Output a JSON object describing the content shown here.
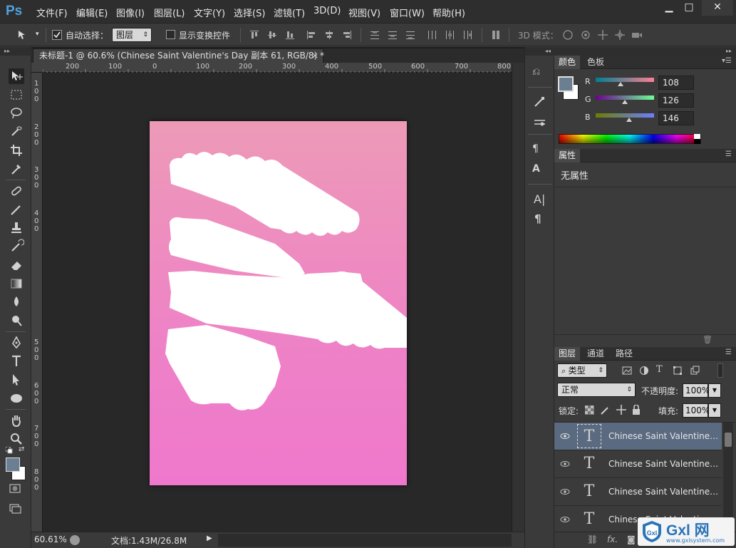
{
  "app": {
    "logo": "Ps",
    "menu": [
      "文件(F)",
      "编辑(E)",
      "图像(I)",
      "图层(L)",
      "文字(Y)",
      "选择(S)",
      "滤镜(T)",
      "3D(D)",
      "视图(V)",
      "窗口(W)",
      "帮助(H)"
    ],
    "window_controls": {
      "minimize": "▁",
      "maximize": "□",
      "close": "✕"
    }
  },
  "options_bar": {
    "auto_select_label": "自动选择：",
    "auto_select_value": "图层",
    "show_transform_label": "显示变换控件",
    "mode_3d_label": "3D 模式："
  },
  "document": {
    "tab_title": "未标题-1 @ 60.6% (Chinese   Saint   Valentine's   Day 副本 61, RGB/8) *",
    "tab_close": "×",
    "ruler_h_labels": [
      "200",
      "100",
      "0",
      "100",
      "200",
      "300",
      "400",
      "500",
      "600",
      "700",
      "800"
    ],
    "ruler_v_labels": [
      "1",
      "0",
      "0",
      "2",
      "0",
      "0",
      "3",
      "0",
      "0",
      "4",
      "0",
      "0",
      "5",
      "0",
      "0",
      "6",
      "0",
      "0",
      "7",
      "0",
      "0",
      "8",
      "0",
      "0"
    ],
    "zoom": "60.61%",
    "doc_size": "文档:1.43M/26.8M"
  },
  "color_panel": {
    "tabs": [
      "颜色",
      "色板"
    ],
    "r_label": "R",
    "g_label": "G",
    "b_label": "B",
    "r_value": "108",
    "g_value": "126",
    "b_value": "146",
    "foreground": "#6c7e92"
  },
  "properties_panel": {
    "tab": "属性",
    "empty_text": "无属性"
  },
  "layers_panel": {
    "tabs": [
      "图层",
      "通道",
      "路径"
    ],
    "filter_label": "类型",
    "blend_mode": "正常",
    "opacity_label": "不透明度:",
    "opacity_value": "100%",
    "lock_label": "锁定:",
    "fill_label": "填充:",
    "fill_value": "100%",
    "layers": [
      {
        "name": "Chinese  Saint  Valentine's ...",
        "thumb": "T",
        "selected": true
      },
      {
        "name": "Chinese  Saint  Valentine's ...",
        "thumb": "T",
        "selected": false
      },
      {
        "name": "Chinese  Saint  Valentine's ...",
        "thumb": "T",
        "selected": false
      },
      {
        "name": "Chinese  Saint  Valentine's ...",
        "thumb": "T",
        "selected": false
      }
    ]
  },
  "watermark": {
    "brand": "Gxl 网",
    "url": "www.gxlsystem.com"
  }
}
